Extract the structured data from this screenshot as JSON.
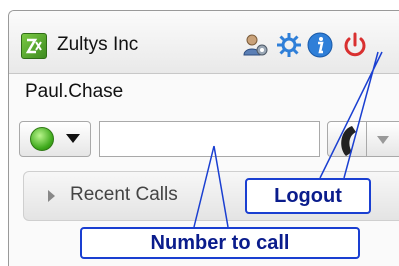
{
  "header": {
    "company_name": "Zultys Inc",
    "icons": [
      "logo-icon",
      "user-settings-icon",
      "gear-icon",
      "info-icon",
      "power-icon"
    ],
    "power_color": "#d93030",
    "accent_color": "#2f7fd8"
  },
  "user": {
    "name": "Paul.Chase"
  },
  "dial": {
    "status_color": "#3ea91c",
    "number_value": "",
    "number_placeholder": ""
  },
  "sections": {
    "recent_calls_label": "Recent Calls"
  },
  "callouts": {
    "logout": "Logout",
    "number_to_call": "Number to call",
    "color": "#1a3fd1"
  }
}
